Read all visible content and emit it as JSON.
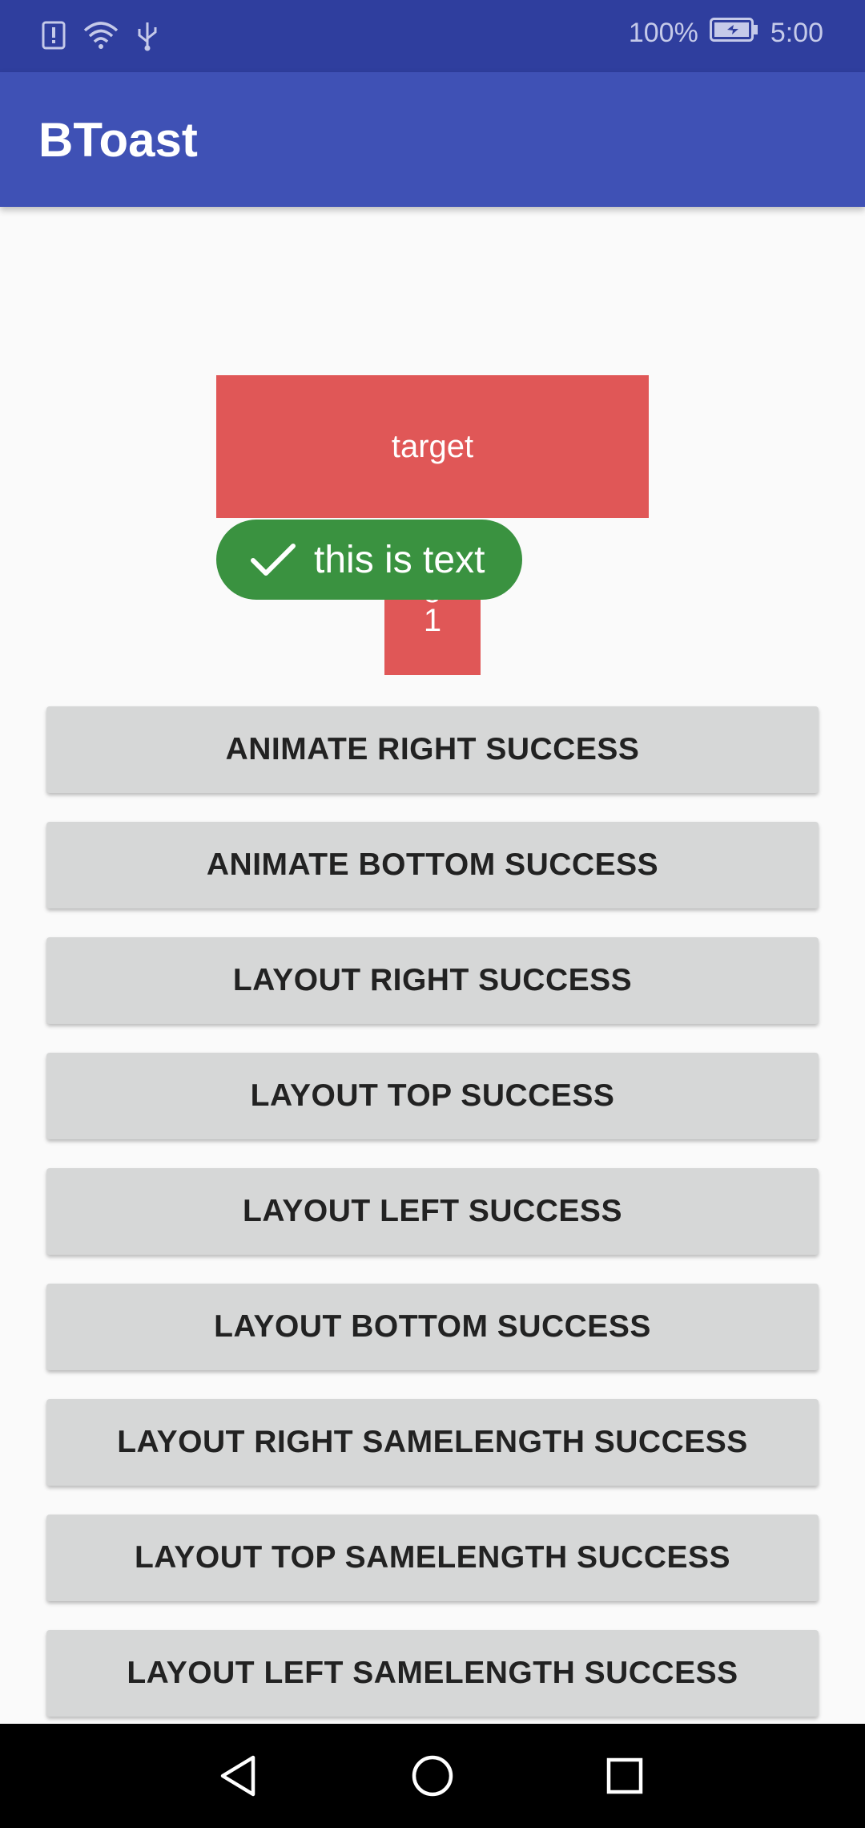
{
  "status_bar": {
    "battery": "100%",
    "time": "5:00",
    "icons": [
      "alert-icon",
      "wifi-icon",
      "usb-icon",
      "battery-icon"
    ]
  },
  "app_bar": {
    "title": "BToast"
  },
  "demo": {
    "target_label": "target",
    "small_target_label": "g\n1",
    "small_target_line1": "g",
    "small_target_line2": "1"
  },
  "toast": {
    "icon": "check-icon",
    "text": "this is text",
    "color": "#3a9240"
  },
  "buttons": [
    "ANIMATE RIGHT SUCCESS",
    "ANIMATE BOTTOM SUCCESS",
    "LAYOUT RIGHT SUCCESS",
    "LAYOUT TOP SUCCESS",
    "LAYOUT LEFT SUCCESS",
    "LAYOUT BOTTOM SUCCESS",
    "LAYOUT RIGHT SAMELENGTH SUCCESS",
    "LAYOUT TOP SAMELENGTH SUCCESS",
    "LAYOUT LEFT SAMELENGTH SUCCESS"
  ],
  "colors": {
    "status_bar": "#2f3e9e",
    "app_bar": "#3f51b5",
    "target": "#e05757",
    "button_bg": "#d6d7d7"
  },
  "nav_bar": {
    "icons": [
      "back-icon",
      "home-icon",
      "recents-icon"
    ]
  }
}
